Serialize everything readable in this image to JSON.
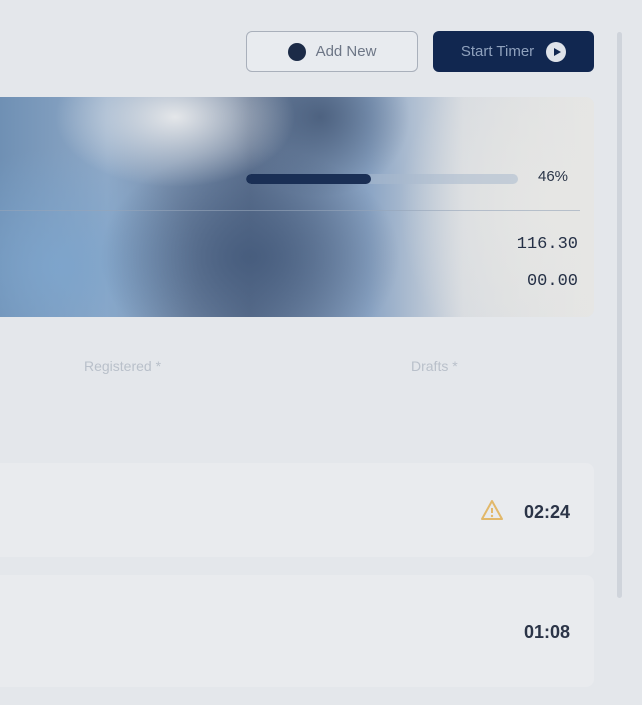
{
  "header": {
    "add_new_label": "Add New",
    "start_timer_label": "Start Timer"
  },
  "hero": {
    "progress_percent": 46,
    "progress_label": "46%",
    "stat_primary": "116.30",
    "stat_secondary": "00.00"
  },
  "columns": {
    "registered": "Registered *",
    "drafts": "Drafts *"
  },
  "rows": [
    {
      "time": "02:24",
      "warning": true,
      "icon": "warning-icon"
    },
    {
      "time": "01:08",
      "warning": false
    }
  ],
  "colors": {
    "primary": "#112750",
    "warning": "#e2b86a"
  }
}
